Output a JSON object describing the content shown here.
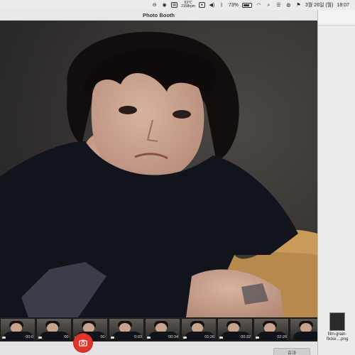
{
  "menubar": {
    "temperature": "63°C",
    "fan_speed": "2158rpm",
    "battery_percent": "73%",
    "date": "3월 26일 (월)",
    "time": "18:07",
    "icons": [
      "minus-circle-icon",
      "chat-bubble-icon",
      "screen-record-icon",
      "stats-icon",
      "app-icon",
      "volume-icon",
      "bluetooth-icon",
      "battery-icon",
      "wifi-icon",
      "search-icon",
      "control-center-icon",
      "siri-icon",
      "flag-icon"
    ]
  },
  "window": {
    "title": "Photo Booth"
  },
  "thumbnails": [
    {
      "time": "00:0"
    },
    {
      "time": "00:"
    },
    {
      "time": "00:"
    },
    {
      "time": "0:03"
    },
    {
      "time": "00:34"
    },
    {
      "time": "01:26"
    },
    {
      "time": "00:32"
    },
    {
      "time": "02:26"
    },
    {
      "time": ""
    }
  ],
  "controls": {
    "effects_label": "효과"
  },
  "desktop": {
    "file_label": "film-grain-flicke....png"
  },
  "colors": {
    "shutter": "#e0352b",
    "menubar_bg": "#ececee"
  }
}
